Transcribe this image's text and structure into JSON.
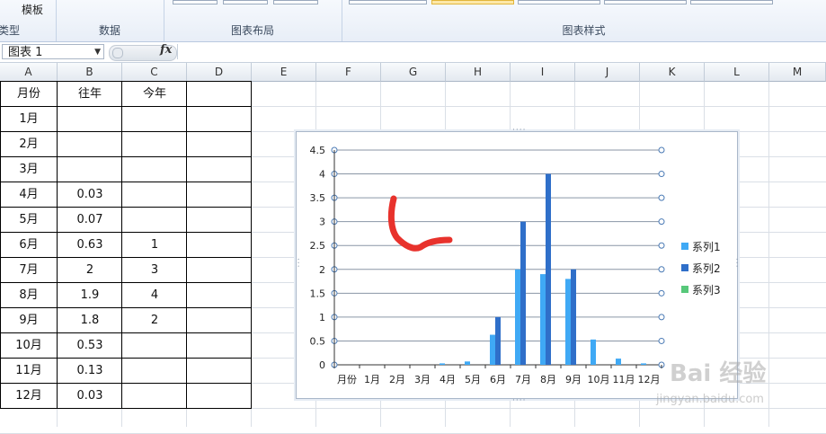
{
  "ribbon": {
    "type_label": "类型",
    "template_label": "模板",
    "data_label": "数据",
    "layout_label": "图表布局",
    "style_label": "图表样式"
  },
  "formula_bar": {
    "name_box": "图表 1",
    "fx": "fx",
    "content": ""
  },
  "columns": [
    "A",
    "B",
    "C",
    "D",
    "E",
    "F",
    "G",
    "H",
    "I",
    "J",
    "K",
    "L",
    "M"
  ],
  "table": {
    "headers": [
      "月份",
      "往年",
      "今年"
    ],
    "rows": [
      [
        "1月",
        "",
        ""
      ],
      [
        "2月",
        "",
        ""
      ],
      [
        "3月",
        "",
        ""
      ],
      [
        "4月",
        "0.03",
        ""
      ],
      [
        "5月",
        "0.07",
        ""
      ],
      [
        "6月",
        "0.63",
        "1"
      ],
      [
        "7月",
        "2",
        "3"
      ],
      [
        "8月",
        "1.9",
        "4"
      ],
      [
        "9月",
        "1.8",
        "2"
      ],
      [
        "10月",
        "0.53",
        ""
      ],
      [
        "11月",
        "0.13",
        ""
      ],
      [
        "12月",
        "0.03",
        ""
      ]
    ]
  },
  "chart_data": {
    "type": "bar",
    "categories": [
      "月份",
      "1月",
      "2月",
      "3月",
      "4月",
      "5月",
      "6月",
      "7月",
      "8月",
      "9月",
      "10月",
      "11月",
      "12月"
    ],
    "series": [
      {
        "name": "系列1",
        "color": "#3fa9f5",
        "values": [
          0,
          0,
          0,
          0,
          0.03,
          0.07,
          0.63,
          2,
          1.9,
          1.8,
          0.53,
          0.13,
          0.03
        ]
      },
      {
        "name": "系列2",
        "color": "#2f6fc9",
        "values": [
          0,
          0,
          0,
          0,
          0,
          0,
          1,
          3,
          4,
          2,
          0,
          0,
          0
        ]
      },
      {
        "name": "系列3",
        "color": "#57c87a",
        "values": [
          0,
          0,
          0,
          0,
          0,
          0,
          0,
          0,
          0,
          0,
          0,
          0,
          0
        ]
      }
    ],
    "yticks": [
      "0",
      "0.5",
      "1",
      "1.5",
      "2",
      "2.5",
      "3",
      "3.5",
      "4",
      "4.5"
    ],
    "ylim": [
      0,
      4.5
    ],
    "grid": true,
    "legend": "right",
    "annotation_color": "#e8322c"
  },
  "watermark": {
    "text": "Bai 经验",
    "sub": "jingyan.baidu.com"
  }
}
